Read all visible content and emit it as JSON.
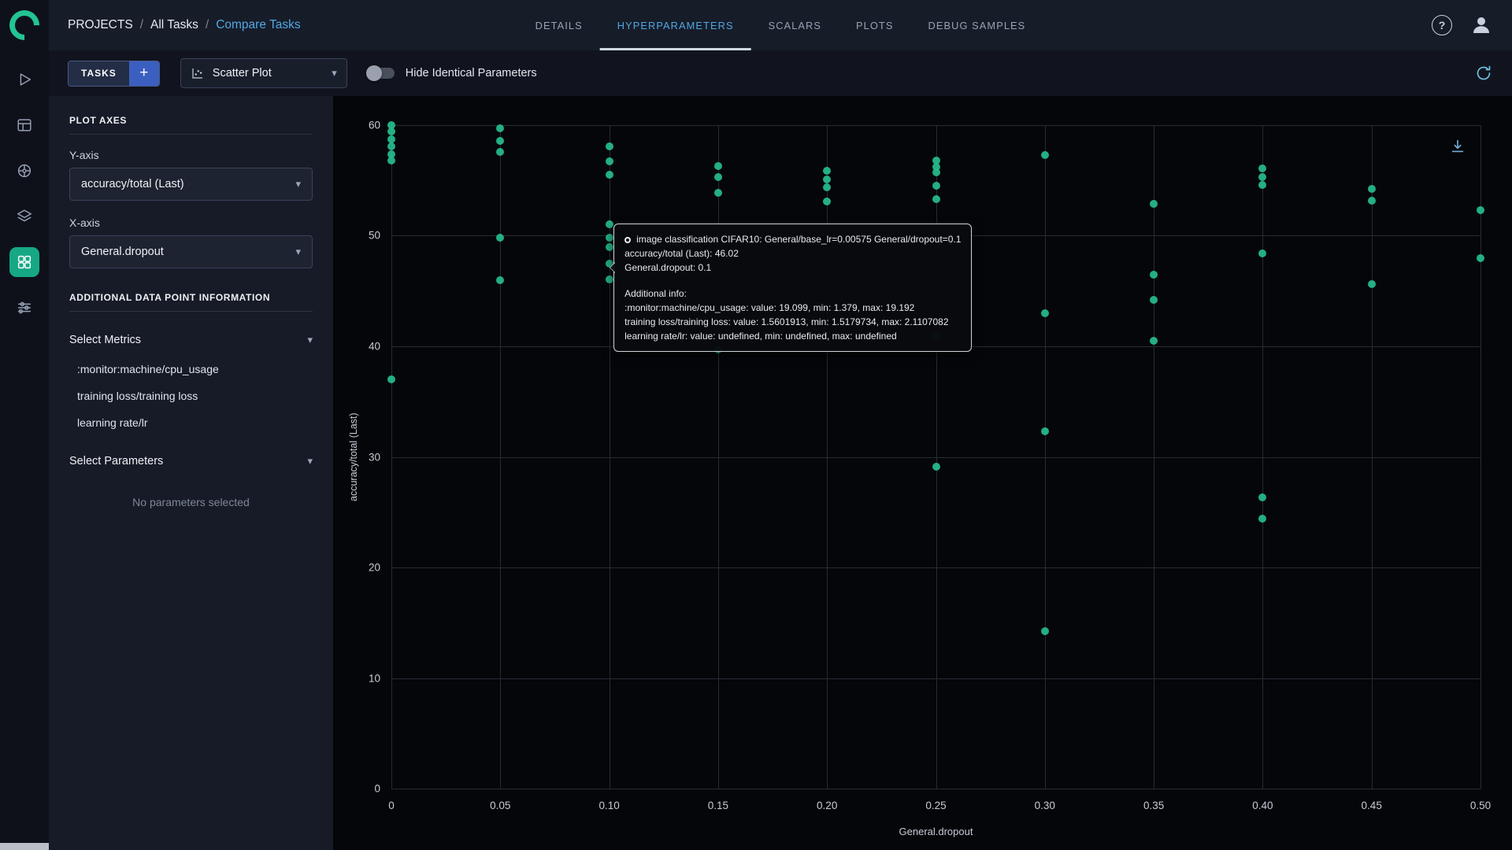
{
  "ui": {
    "caret": "▾"
  },
  "accent": {
    "teal": "#27bd8d",
    "blue": "#4fa9e2",
    "active_rail": "#16a885"
  },
  "sidebar_rail": {
    "icons": [
      "clearml-logo",
      "projects-icon",
      "datasets-icon",
      "pipelines-icon",
      "reports-icon",
      "applications-icon",
      "orchestration-icon"
    ],
    "active": "applications-icon"
  },
  "header": {
    "breadcrumb": {
      "root": "PROJECTS",
      "sep": "/",
      "mid": "All Tasks",
      "current": "Compare Tasks"
    },
    "tabs": [
      {
        "label": "DETAILS",
        "active": false
      },
      {
        "label": "HYPERPARAMETERS",
        "active": true
      },
      {
        "label": "SCALARS",
        "active": false
      },
      {
        "label": "PLOTS",
        "active": false
      },
      {
        "label": "DEBUG SAMPLES",
        "active": false
      }
    ],
    "help_label": "?"
  },
  "toolbar": {
    "tasks_button": "TASKS",
    "add_button": "+",
    "plot_type": "Scatter Plot",
    "toggle_label": "Hide Identical Parameters",
    "toggle_state": "off"
  },
  "panel": {
    "plot_axes_title": "PLOT AXES",
    "y_axis_label": "Y-axis",
    "y_axis_value": "accuracy/total (Last)",
    "x_axis_label": "X-axis",
    "x_axis_value": "General.dropout",
    "additional_title": "ADDITIONAL DATA POINT INFORMATION",
    "select_metrics_label": "Select Metrics",
    "metrics": [
      ":monitor:machine/cpu_usage",
      "training loss/training loss",
      "learning rate/lr"
    ],
    "select_parameters_label": "Select Parameters",
    "no_parameters_text": "No parameters selected"
  },
  "tooltip": {
    "title": "image classification CIFAR10: General/base_lr=0.00575 General/dropout=0.1",
    "line2": "accuracy/total (Last): 46.02",
    "line3": "General.dropout: 0.1",
    "additional_header": "Additional info:",
    "info": [
      ":monitor:machine/cpu_usage: value: 19.099, min: 1.379, max: 19.192",
      "training loss/training loss: value: 1.5601913, min: 1.5179734, max: 2.1107082",
      "learning rate/lr: value: undefined, min: undefined, max: undefined"
    ]
  },
  "chart_data": {
    "type": "scatter",
    "title": "",
    "xlabel": "General.dropout",
    "ylabel": "accuracy/total (Last)",
    "xlim": [
      0,
      0.5
    ],
    "ylim": [
      0,
      60
    ],
    "grid": true,
    "legend": false,
    "point_color": "#27bd8d",
    "x_ticks": [
      0,
      0.05,
      0.1,
      0.15,
      0.2,
      0.25,
      0.3,
      0.35,
      0.4,
      0.45,
      0.5
    ],
    "x_tick_labels": [
      "0",
      "0.05",
      "0.10",
      "0.15",
      "0.20",
      "0.25",
      "0.30",
      "0.35",
      "0.40",
      "0.45",
      "0.50"
    ],
    "y_ticks": [
      0,
      10,
      20,
      30,
      40,
      50,
      60
    ],
    "y_tick_labels": [
      "0",
      "10",
      "20",
      "30",
      "40",
      "50",
      "60"
    ],
    "points": [
      [
        0,
        60.0
      ],
      [
        0,
        59.4
      ],
      [
        0,
        58.7
      ],
      [
        0,
        58.1
      ],
      [
        0,
        57.4
      ],
      [
        0,
        56.8
      ],
      [
        0,
        37.0
      ],
      [
        0.05,
        59.7
      ],
      [
        0.05,
        58.6
      ],
      [
        0.05,
        57.6
      ],
      [
        0.05,
        49.8
      ],
      [
        0.05,
        46.0
      ],
      [
        0.1,
        58.1
      ],
      [
        0.1,
        56.7
      ],
      [
        0.1,
        55.5
      ],
      [
        0.1,
        51.0
      ],
      [
        0.1,
        49.8
      ],
      [
        0.1,
        49.0
      ],
      [
        0.1,
        47.5
      ],
      [
        0.1,
        46.02
      ],
      [
        0.15,
        56.3
      ],
      [
        0.15,
        55.3
      ],
      [
        0.15,
        53.9
      ],
      [
        0.15,
        39.7
      ],
      [
        0.2,
        55.9
      ],
      [
        0.2,
        55.1
      ],
      [
        0.2,
        54.4
      ],
      [
        0.2,
        53.1
      ],
      [
        0.25,
        56.8
      ],
      [
        0.25,
        56.2
      ],
      [
        0.25,
        55.7
      ],
      [
        0.25,
        54.5
      ],
      [
        0.25,
        53.3
      ],
      [
        0.25,
        40.9
      ],
      [
        0.25,
        29.1
      ],
      [
        0.3,
        57.3
      ],
      [
        0.3,
        43.0
      ],
      [
        0.3,
        32.3
      ],
      [
        0.3,
        14.2
      ],
      [
        0.35,
        52.9
      ],
      [
        0.35,
        46.5
      ],
      [
        0.35,
        44.2
      ],
      [
        0.35,
        40.5
      ],
      [
        0.4,
        56.1
      ],
      [
        0.4,
        55.3
      ],
      [
        0.4,
        54.6
      ],
      [
        0.4,
        48.4
      ],
      [
        0.4,
        26.3
      ],
      [
        0.4,
        24.4
      ],
      [
        0.45,
        54.2
      ],
      [
        0.45,
        53.2
      ],
      [
        0.45,
        45.6
      ],
      [
        0.5,
        52.3
      ],
      [
        0.5,
        48.0
      ]
    ]
  }
}
